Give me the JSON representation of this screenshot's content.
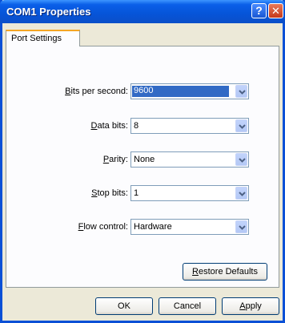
{
  "window": {
    "title": "COM1 Properties",
    "help_glyph": "?",
    "close_glyph": "✕"
  },
  "tabs": [
    {
      "label": "Port Settings"
    }
  ],
  "fields": [
    {
      "key": "P",
      "label_pre": "",
      "label_u": "B",
      "label_post": "its per second:",
      "value": "9600"
    },
    {
      "key": "P",
      "label_pre": "",
      "label_u": "D",
      "label_post": "ata bits:",
      "value": "8"
    },
    {
      "key": "P",
      "label_pre": "",
      "label_u": "P",
      "label_post": "arity:",
      "value": "None"
    },
    {
      "key": "P",
      "label_pre": "",
      "label_u": "S",
      "label_post": "top bits:",
      "value": "1"
    },
    {
      "key": "P",
      "label_pre": "",
      "label_u": "F",
      "label_post": "low control:",
      "value": "Hardware"
    }
  ],
  "restore_btn": {
    "u": "R",
    "rest": "estore Defaults"
  },
  "footer": {
    "ok": "OK",
    "cancel": "Cancel",
    "apply_u": "A",
    "apply_rest": "pply"
  },
  "colors": {
    "title_blue": "#0654d8",
    "selection": "#316ac5",
    "face": "#ece9d8"
  }
}
